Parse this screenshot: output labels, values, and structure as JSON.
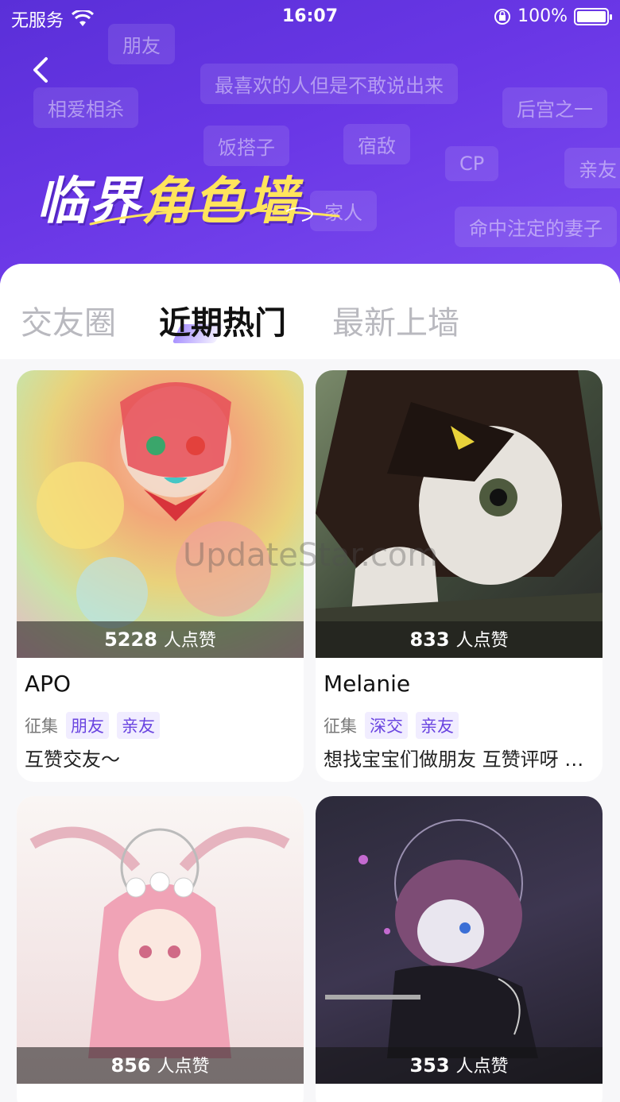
{
  "status_bar": {
    "carrier": "无服务",
    "time": "16:07",
    "battery": "100%"
  },
  "header": {
    "title_part1": "临界",
    "title_highlight": "角色墙",
    "chips": [
      "朋友",
      "最喜欢的人但是不敢说出来",
      "相爱相杀",
      "后宫之一",
      "饭搭子",
      "宿敌",
      "CP",
      "亲友",
      "家人",
      "命中注定的妻子"
    ]
  },
  "tabs": [
    {
      "label": "交友圈"
    },
    {
      "label": "近期热门"
    },
    {
      "label": "最新上墙"
    }
  ],
  "watermark": "UpdateStar.com",
  "cards": [
    {
      "likes": "5228",
      "likes_suffix": "人点赞",
      "name": "APO",
      "tag_label": "征集",
      "tags": [
        "朋友",
        "亲友"
      ],
      "desc": "互赞交友～"
    },
    {
      "likes": "833",
      "likes_suffix": "人点赞",
      "name": "Melanie",
      "tag_label": "征集",
      "tags": [
        "深交",
        "亲友"
      ],
      "desc": "想找宝宝们做朋友 互赞评呀 …"
    },
    {
      "likes": "856",
      "likes_suffix": "人点赞"
    },
    {
      "likes": "353",
      "likes_suffix": "人点赞"
    }
  ],
  "colors": {
    "header_start": "#5a2fd8",
    "header_end": "#7c4cf0",
    "accent": "#6a45e0",
    "title_highlight": "#ffe45c"
  }
}
